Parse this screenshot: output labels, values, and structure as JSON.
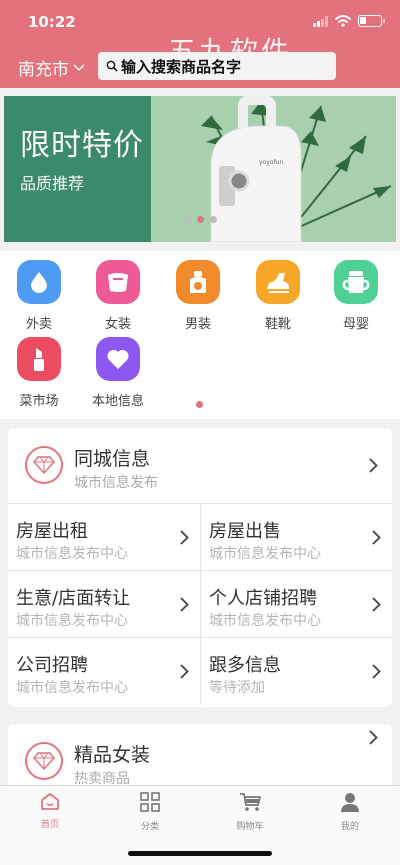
{
  "status": {
    "time": "10:22"
  },
  "header": {
    "watermark": "五九软件",
    "city": "南充市",
    "search_placeholder": "输入搜索商品名字",
    "color": "#e4727d"
  },
  "banner": {
    "title": "限时特价",
    "subtitle": "品质推荐",
    "product_brand": "yoyofun"
  },
  "categories": [
    {
      "label": "外卖",
      "icon": "water-drop-icon",
      "color": "#4d9bf5"
    },
    {
      "label": "女装",
      "icon": "dress-icon",
      "color": "#ee5a96"
    },
    {
      "label": "男装",
      "icon": "shirt-icon",
      "color": "#f18a2b"
    },
    {
      "label": "鞋靴",
      "icon": "shoe-icon",
      "color": "#f8a626"
    },
    {
      "label": "母婴",
      "icon": "baby-bottle-icon",
      "color": "#4fd196"
    },
    {
      "label": "菜市场",
      "icon": "lipstick-icon",
      "color": "#ec4c61"
    },
    {
      "label": "本地信息",
      "icon": "heart-icon",
      "color": "#8d58f0"
    }
  ],
  "section1": {
    "title": "同城信息",
    "subtitle": "城市信息发布",
    "items": [
      {
        "title": "房屋出租",
        "subtitle": "城市信息发布中心"
      },
      {
        "title": "房屋出售",
        "subtitle": "城市信息发布中心"
      },
      {
        "title": "生意/店面转让",
        "subtitle": "城市信息发布中心"
      },
      {
        "title": "个人店铺招聘",
        "subtitle": "城市信息发布中心"
      },
      {
        "title": "公司招聘",
        "subtitle": "城市信息发布中心"
      },
      {
        "title": "跟多信息",
        "subtitle": "等待添加"
      }
    ]
  },
  "section2": {
    "title": "精品女装",
    "subtitle": "热卖商品"
  },
  "tabs": [
    {
      "label": "首页",
      "icon": "home-icon",
      "active": true
    },
    {
      "label": "分类",
      "icon": "grid-icon",
      "active": false
    },
    {
      "label": "购物车",
      "icon": "cart-icon",
      "active": false
    },
    {
      "label": "我的",
      "icon": "user-icon",
      "active": false
    }
  ]
}
